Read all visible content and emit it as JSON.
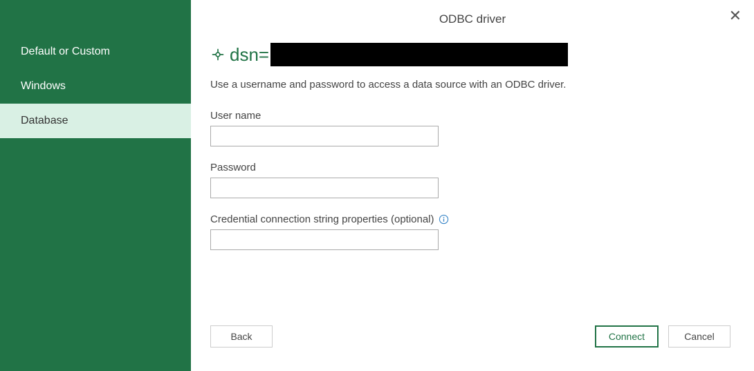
{
  "dialog": {
    "title": "ODBC driver",
    "close_label": "✕"
  },
  "sidebar": {
    "items": [
      {
        "label": "Default or Custom",
        "selected": false
      },
      {
        "label": "Windows",
        "selected": false
      },
      {
        "label": "Database",
        "selected": true
      }
    ]
  },
  "main": {
    "dsn_prefix": "dsn=",
    "dsn_value_redacted": true,
    "description": "Use a username and password to access a data source with an ODBC driver.",
    "fields": {
      "username_label": "User name",
      "username_value": "",
      "password_label": "Password",
      "password_value": "",
      "conn_props_label": "Credential connection string properties (optional)",
      "conn_props_value": ""
    }
  },
  "buttons": {
    "back": "Back",
    "connect": "Connect",
    "cancel": "Cancel"
  },
  "colors": {
    "accent": "#217346",
    "sidebar_selected_bg": "#d9f0e4"
  }
}
